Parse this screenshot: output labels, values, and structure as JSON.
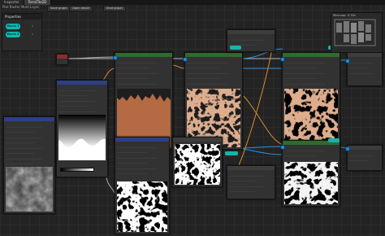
{
  "window": {
    "tabs": [
      {
        "label": "Inspector"
      },
      {
        "label": "TerraTile2D"
      }
    ],
    "subtitle": "Plot Raster Multi Layer"
  },
  "toolbar": {
    "save_graph": "Save graph",
    "open_result": "Open result",
    "shot_graph": "Shot graph"
  },
  "properties": {
    "title": "Properties",
    "items": [
      {
        "label": "World 1",
        "value": "0"
      },
      {
        "label": "World 2",
        "value": "0"
      }
    ]
  },
  "minimap": {
    "title": "Minimap: 0.78x"
  },
  "colors": {
    "accent_teal": "#16b3ad",
    "port_blue": "#1b8fdd",
    "wire_orange": "#d88a2a",
    "wire_blue": "#2f8fd8",
    "header_green": "#2e6b2e",
    "header_blue": "#2d3f87",
    "header_red": "#8c2b2b"
  }
}
